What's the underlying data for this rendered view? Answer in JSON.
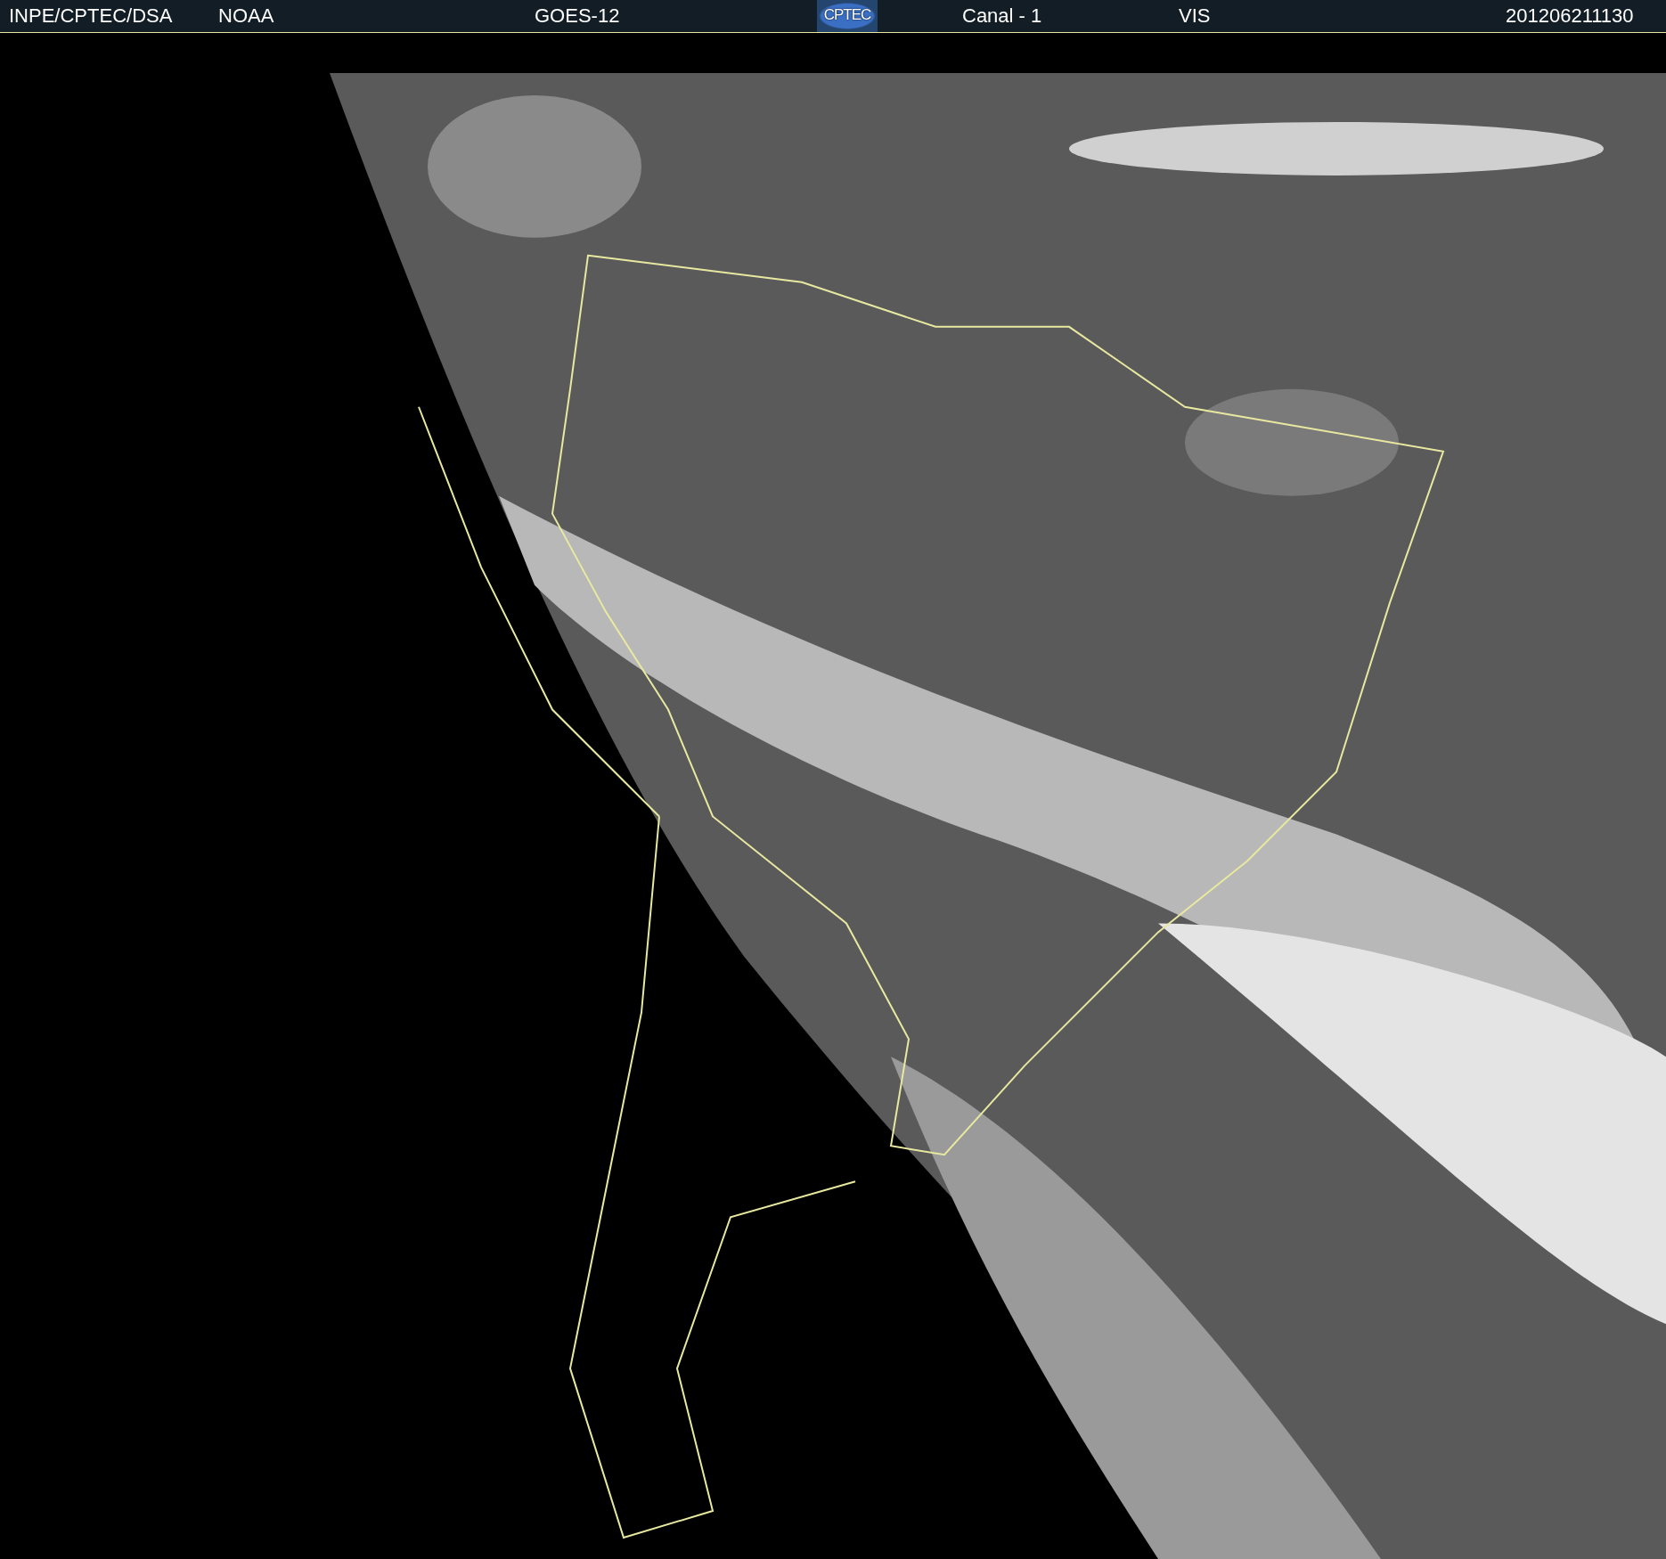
{
  "header": {
    "items": [
      {
        "text": "INPE/CPTEC/DSA"
      },
      {
        "text": "NOAA"
      },
      {
        "text": "GOES-12"
      },
      {
        "kind": "logo",
        "text": "CPTEC"
      },
      {
        "text": "Canal - 1"
      },
      {
        "text": "VIS"
      },
      {
        "text": "201206211130"
      }
    ]
  }
}
